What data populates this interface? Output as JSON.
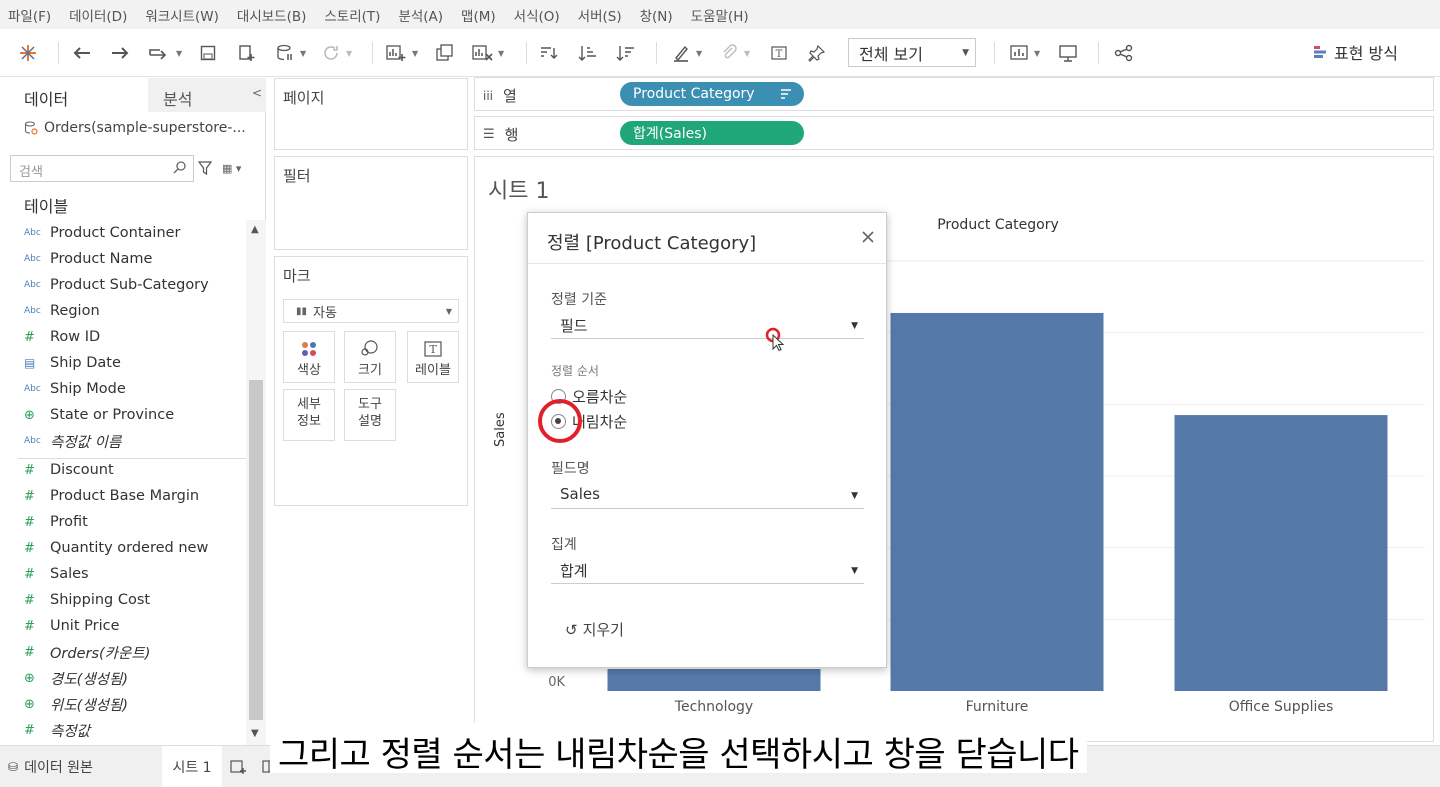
{
  "menu": [
    "파일(F)",
    "데이터(D)",
    "워크시트(W)",
    "대시보드(B)",
    "스토리(T)",
    "분석(A)",
    "맵(M)",
    "서식(O)",
    "서버(S)",
    "창(N)",
    "도움말(H)"
  ],
  "toolbar": {
    "view_mode": "전체 보기",
    "show_me": "표현 방식"
  },
  "left_pane": {
    "tab_data": "데이터",
    "tab_analysis": "분석",
    "datasource": "Orders(sample-superstore-...",
    "search_placeholder": "검색",
    "tables_title": "테이블",
    "dimensions": [
      {
        "type": "Abc",
        "name": "Product Container"
      },
      {
        "type": "Abc",
        "name": "Product Name"
      },
      {
        "type": "Abc",
        "name": "Product Sub-Category"
      },
      {
        "type": "Abc",
        "name": "Region"
      },
      {
        "type": "#",
        "name": "Row ID"
      },
      {
        "type": "date",
        "name": "Ship Date"
      },
      {
        "type": "Abc",
        "name": "Ship Mode"
      },
      {
        "type": "geo",
        "name": "State or Province"
      },
      {
        "type": "Abc",
        "name": "측정값 이름"
      }
    ],
    "measures": [
      {
        "type": "#",
        "name": "Discount"
      },
      {
        "type": "#",
        "name": "Product Base Margin"
      },
      {
        "type": "#",
        "name": "Profit"
      },
      {
        "type": "#",
        "name": "Quantity ordered new"
      },
      {
        "type": "#",
        "name": "Sales"
      },
      {
        "type": "#",
        "name": "Shipping Cost"
      },
      {
        "type": "#",
        "name": "Unit Price"
      },
      {
        "type": "#",
        "name": "Orders(카운트)"
      },
      {
        "type": "geo",
        "name": "경도(생성됨)"
      },
      {
        "type": "geo",
        "name": "위도(생성됨)"
      },
      {
        "type": "#",
        "name": "측정값"
      }
    ]
  },
  "cards": {
    "pages": "페이지",
    "filters": "필터",
    "marks": "마크",
    "marks_type": "자동",
    "color": "색상",
    "size": "크기",
    "label": "레이블",
    "detail_1": "세부",
    "detail_2": "정보",
    "tooltip_1": "도구",
    "tooltip_2": "설명"
  },
  "shelves": {
    "columns_label": "열",
    "rows_label": "행",
    "columns_pill": "Product Category",
    "rows_pill": "합계(Sales)"
  },
  "sheet": {
    "title": "시트 1",
    "header": "Product Category",
    "y_title": "Sales"
  },
  "chart_data": {
    "type": "bar",
    "title": "",
    "xlabel": "",
    "ylabel": "Sales",
    "header": "Product Category",
    "categories": [
      "Technology",
      "Furniture",
      "Office Supplies"
    ],
    "values": [
      null,
      5275000,
      3850000
    ],
    "value_units": "estimated",
    "yticks_visible": [
      "0K"
    ],
    "bar_color": "#5579a9"
  },
  "dialog": {
    "title": "정렬 [Product Category]",
    "sort_by_label": "정렬 기준",
    "sort_by_value": "필드",
    "sort_order_label": "정렬 순서",
    "ascending": "오름차순",
    "descending": "내림차순",
    "selected_order": "descending",
    "field_name_label": "필드명",
    "field_name_value": "Sales",
    "aggregation_label": "집계",
    "aggregation_value": "합계",
    "clear": "지우기"
  },
  "bottom": {
    "datasource_tab": "데이터 원본",
    "sheet_tab": "시트 1"
  },
  "subtitle": "그리고 정렬 순서는 내림차순을 선택하시고 창을 닫습니다",
  "colors": {
    "accent_blue_pill": "#3a8fb2",
    "green_pill": "#1fa77a",
    "bar": "#5579a9",
    "highlight": "#e0202a"
  }
}
